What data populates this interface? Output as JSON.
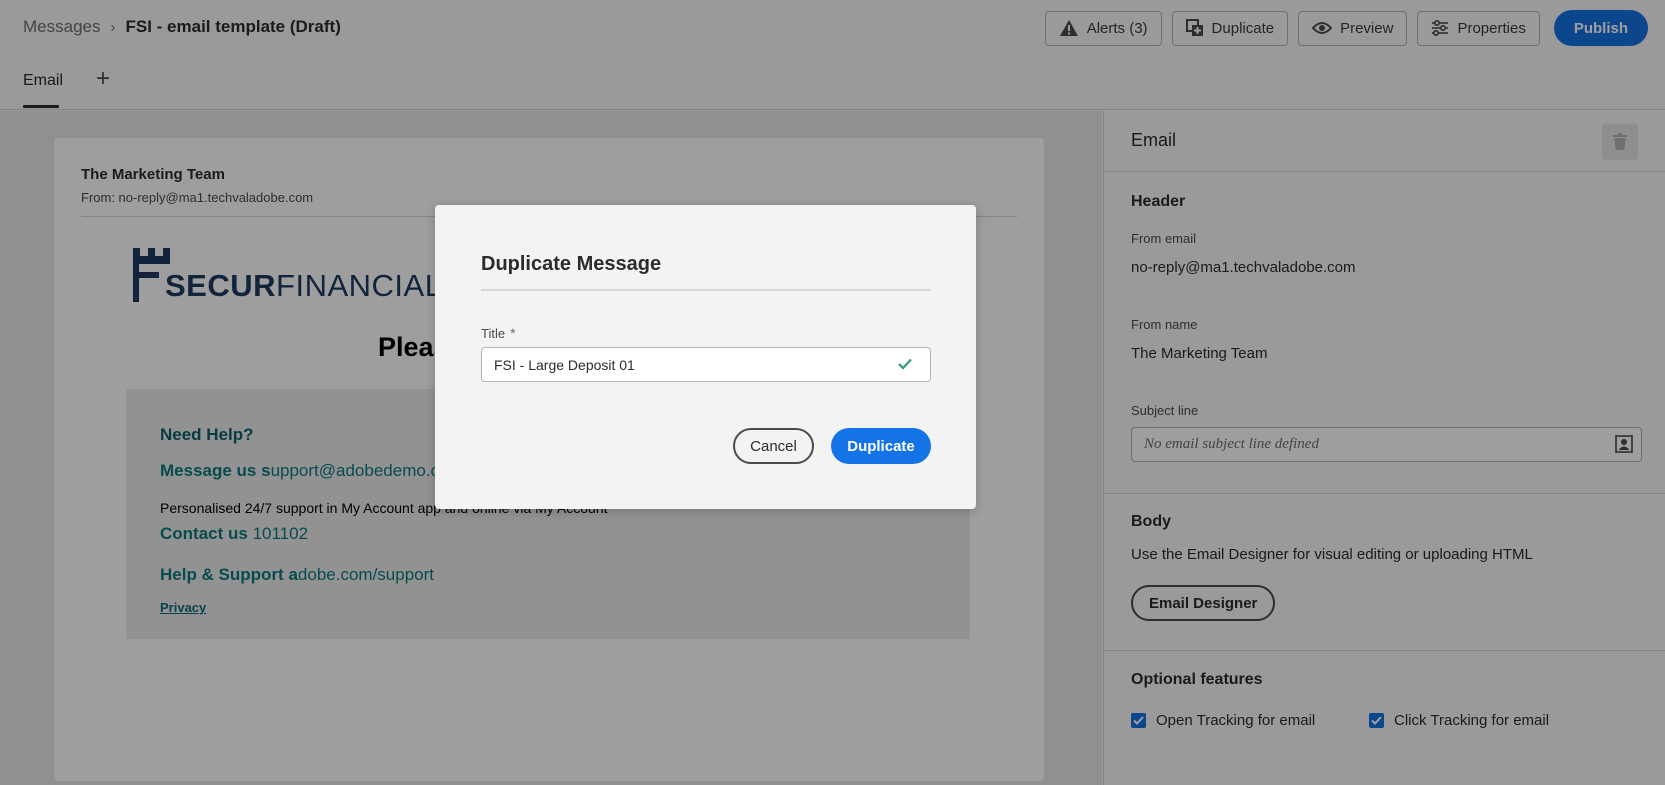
{
  "breadcrumb": {
    "parent": "Messages",
    "current": "FSI - email template (Draft)"
  },
  "toolbar": {
    "alerts_label": "Alerts (3)",
    "duplicate_label": "Duplicate",
    "preview_label": "Preview",
    "properties_label": "Properties",
    "publish_label": "Publish"
  },
  "tabs": {
    "email_label": "Email",
    "add_symbol": "+"
  },
  "preview": {
    "sender_name": "The Marketing Team",
    "sender_from": "From: no-reply@ma1.techvaladobe.com",
    "logo_bold": "SECUR",
    "logo_light": "FINANCIAL",
    "heading_partial": "Pleas",
    "help_title": "Need Help?",
    "message_label": "Message us s",
    "message_value": "upport@adobedemo.c",
    "support_text": "Personalised 24/7 support in My Account app and online via My Account",
    "contact_label": "Contact us",
    "contact_value": " 101102",
    "help_support_label": "Help & Support a",
    "help_support_value": "dobe.com/support",
    "privacy_label": "Privacy"
  },
  "panel": {
    "title": "Email",
    "header_section": "Header",
    "from_email_label": "From email",
    "from_email_value": "no-reply@ma1.techvaladobe.com",
    "from_name_label": "From name",
    "from_name_value": "The Marketing Team",
    "subject_label": "Subject line",
    "subject_placeholder": "No email subject line defined",
    "body_section": "Body",
    "body_desc": "Use the Email Designer for visual editing or uploading HTML",
    "designer_button": "Email Designer",
    "optional_section": "Optional features",
    "open_tracking": "Open Tracking for email",
    "click_tracking": "Click Tracking for email"
  },
  "dialog": {
    "title": "Duplicate Message",
    "field_label": "Title",
    "required_mark": "*",
    "field_value": "FSI - Large Deposit 01",
    "cancel_label": "Cancel",
    "confirm_label": "Duplicate"
  },
  "colors": {
    "accent": "#1473e6",
    "teal_text": "#0d7a80",
    "logo_navy": "#1e3a5f"
  },
  "icons": {
    "alerts": "warning-icon",
    "duplicate": "duplicate-icon",
    "preview": "eye-icon",
    "properties": "sliders-icon",
    "trash": "trash-icon",
    "subject": "personalize-icon",
    "valid": "checkmark-icon"
  }
}
